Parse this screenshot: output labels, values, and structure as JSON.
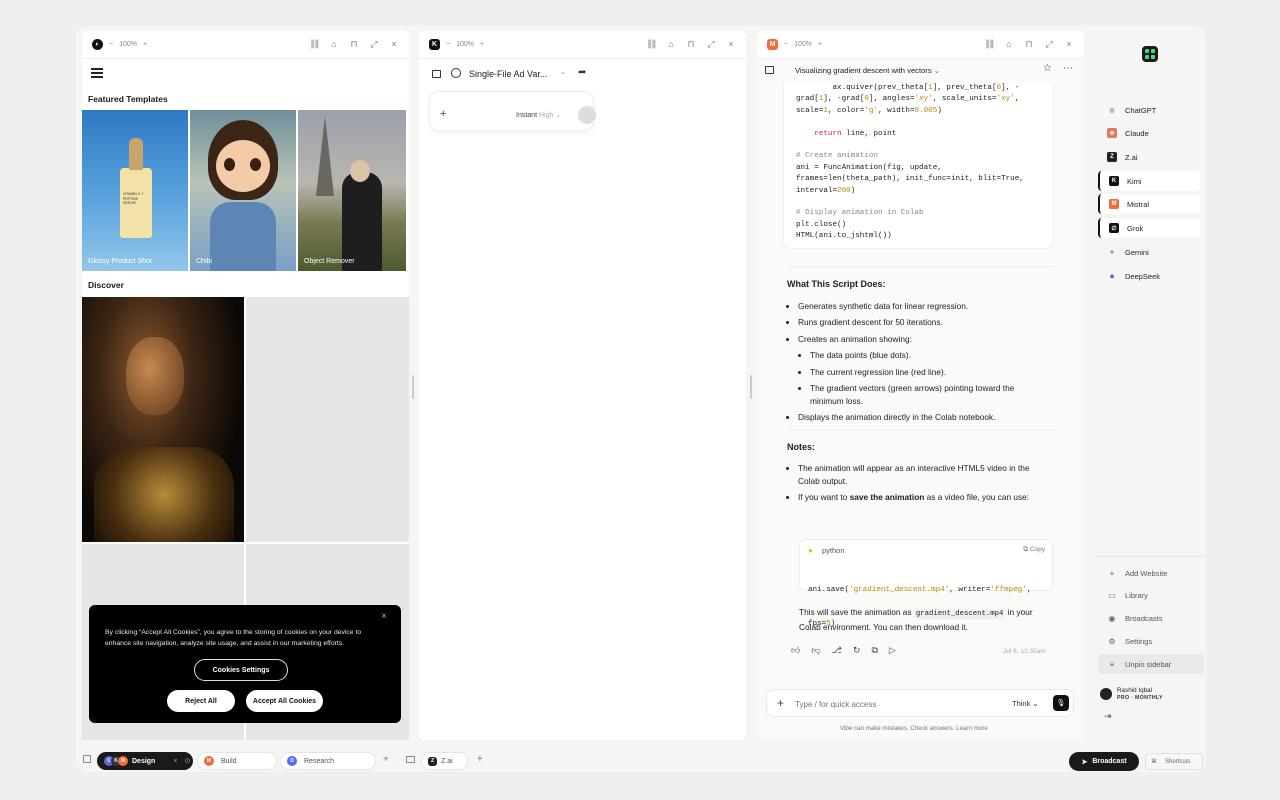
{
  "pane1": {
    "zoom": "100%",
    "featured_title": "Featured Templates",
    "templates": [
      {
        "label": "Glossy Product Shot"
      },
      {
        "label": "Chibi"
      },
      {
        "label": "Object Remover"
      }
    ],
    "bottle_text": "VITAMIN C + PEPTIDE SERUM",
    "discover_title": "Discover",
    "cookie": {
      "text": "By clicking “Accept All Cookies”, you agree to the storing of cookies on your device to enhance site navigation, analyze site usage, and assist in our marketing efforts.",
      "settings": "Cookies Settings",
      "reject": "Reject All",
      "accept": "Accept All Cookies"
    }
  },
  "pane2": {
    "zoom": "100%",
    "title": "Single-File Ad Var...",
    "mode": "Instant",
    "mode_level": "High"
  },
  "pane3": {
    "zoom": "100%",
    "title": "Visualizing gradient descent with vectors",
    "code_lines": [
      "        ax.quiver(prev_theta[1], prev_theta[0], -",
      "grad[1], -grad[0], angles='xy', scale_units='xy',",
      "scale=1, color='g', width=0.005)",
      "",
      "    return line, point",
      "",
      "# Create animation",
      "ani = FuncAnimation(fig, update,",
      "frames=len(theta_path), init_func=init, blit=True,",
      "interval=200)",
      "",
      "# Display animation in Colab",
      "plt.close()",
      "HTML(ani.to_jshtml())"
    ],
    "what_title": "What This Script Does:",
    "what_items": [
      "Generates synthetic data for linear regression.",
      "Runs gradient descent for 50 iterations.",
      "Creates an animation showing:"
    ],
    "what_sub": [
      "The data points (blue dots).",
      "The current regression line (red line).",
      "The gradient vectors (green arrows) pointing toward the minimum loss."
    ],
    "what_last": "Displays the animation directly in the Colab notebook.",
    "notes_title": "Notes:",
    "note1": "The animation will appear as an interactive HTML5 video in the Colab output.",
    "note2_pre": "If you want to ",
    "note2_bold": "save the animation",
    "note2_post": " as a video file, you can use:",
    "snippet_lang": "python",
    "snippet_copy": "Copy",
    "snippet_line1": "ani.save('gradient_descent.mp4', writer='ffmpeg',",
    "snippet_line2": "fps=5)",
    "save_pre": "This will save the animation as ",
    "save_code": "gradient_descent.mp4",
    "save_post": " in your Colab environment. You can then download it.",
    "timestamp": "Jul 6, 12:35am",
    "input_placeholder": "Type / for quick access",
    "think_label": "Think",
    "disclaimer": "Vibe can make mistakes. Check answers. Learn more"
  },
  "sidebar": {
    "models": [
      {
        "name": "ChatGPT",
        "color": "#888"
      },
      {
        "name": "Claude",
        "color": "#e07a5f"
      },
      {
        "name": "Z.ai",
        "color": "#222"
      },
      {
        "name": "Kimi",
        "color": "#111"
      },
      {
        "name": "Mistral",
        "color": "#f26b3a"
      },
      {
        "name": "Grok",
        "color": "#111"
      },
      {
        "name": "Gemini",
        "color": "#4a8cf7"
      },
      {
        "name": "DeepSeek",
        "color": "#4d6bfe"
      }
    ],
    "footer": [
      "Add Website",
      "Library",
      "Broadcasts",
      "Settings",
      "Unpin sidebar"
    ],
    "user_name": "Rashid Iqbal",
    "user_plan": "PRO · MONTHLY"
  },
  "bottombar": {
    "tabs": [
      "Design",
      "Build",
      "Research"
    ],
    "zai_tab": "Z.ai",
    "broadcast": "Broadcast",
    "shortcuts": "Shortcuts",
    "shortcut_key": "⌘"
  }
}
